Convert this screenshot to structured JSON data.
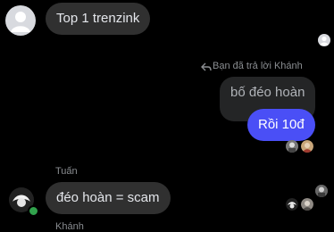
{
  "messages": [
    {
      "text": "Top 1 trenzink",
      "direction": "incoming"
    },
    {
      "reply_label": "Bạn đã trả lời Khánh",
      "quoted_text": "bố đéo hoàn",
      "direction": "outgoing_reply"
    },
    {
      "text": "Rồi 10đ",
      "direction": "outgoing"
    },
    {
      "sender": "Tuấn",
      "text": "đéo hoàn = scam",
      "direction": "incoming"
    }
  ],
  "next_sender": "Khánh",
  "icons": {
    "reply": "reply-arrow-icon",
    "online": "online-dot"
  },
  "colors": {
    "background": "#000000",
    "incoming_bubble": "#303030",
    "outgoing_bubble": "#4a4ff6",
    "quoted_bubble": "#242526",
    "online": "#31a24c"
  }
}
